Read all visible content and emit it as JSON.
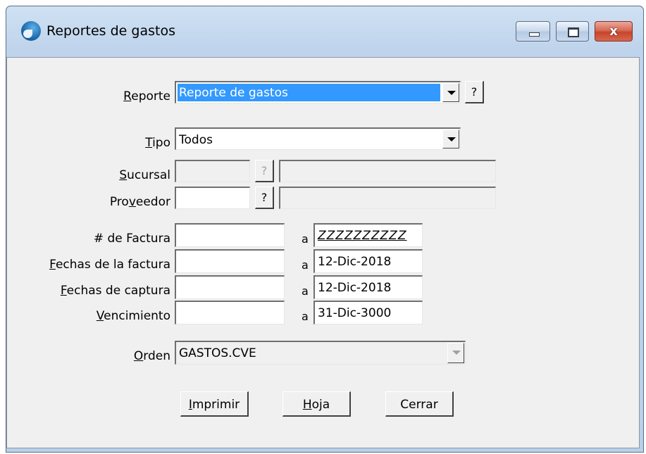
{
  "window": {
    "title": "Reportes de gastos",
    "close_glyph": "x"
  },
  "form": {
    "reporte": {
      "label_pre": "",
      "label_ul": "R",
      "label_post": "eporte",
      "value": "Reporte de gastos",
      "help": "?"
    },
    "tipo": {
      "label_ul": "T",
      "label_post": "ipo",
      "value": "Todos"
    },
    "sucursal": {
      "label_ul": "S",
      "label_post": "ucursal",
      "value": "",
      "desc": "",
      "help": "?"
    },
    "proveedor": {
      "label_pre": "Pro",
      "label_ul": "v",
      "label_post": "eedor",
      "value": "",
      "desc": "",
      "help": "?"
    },
    "factura": {
      "label": "# de Factura",
      "from": "",
      "a": "a",
      "to": "ZZZZZZZZZZ"
    },
    "fechas_factura": {
      "label_ul": "F",
      "label_post": "echas de la factura",
      "from": "",
      "a": "a",
      "to": "12-Dic-2018"
    },
    "fechas_captura": {
      "label_ul": "F",
      "label_post": "echas de captura",
      "from": "",
      "a": "a",
      "to": "12-Dic-2018"
    },
    "vencimiento": {
      "label_ul": "V",
      "label_post": "encimiento",
      "from": "",
      "a": "a",
      "to": "31-Dic-3000"
    },
    "orden": {
      "label_ul": "O",
      "label_post": "rden",
      "value": "GASTOS.CVE"
    }
  },
  "buttons": {
    "imprimir": {
      "ul": "I",
      "rest": "mprimir"
    },
    "hoja": {
      "ul": "H",
      "rest": "oja"
    },
    "cerrar": {
      "label": "Cerrar"
    }
  },
  "colors": {
    "selection": "#3399ff",
    "close_button": "#c8452c",
    "client_bg": "#f0f0f0"
  }
}
